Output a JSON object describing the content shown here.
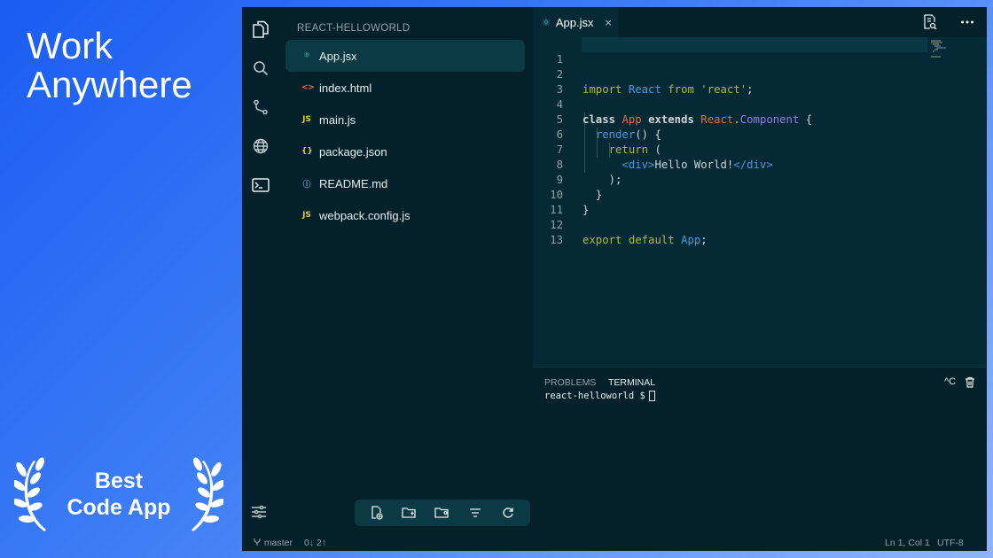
{
  "promo": {
    "headline_line1": "Work",
    "headline_line2": "Anywhere",
    "award_line1": "Best",
    "award_line2": "Code App"
  },
  "activity_bar": {
    "items": [
      "files-icon",
      "search-icon",
      "source-control-icon",
      "globe-icon",
      "terminal-icon"
    ],
    "bottom": "settings-sliders-icon"
  },
  "sidebar": {
    "title": "REACT-HELLOWORLD",
    "files": [
      {
        "name": "App.jsx",
        "icon": "⚛",
        "icon_color": "#6bb8ce",
        "active": true
      },
      {
        "name": "index.html",
        "icon": "<>",
        "icon_color": "#ea6b3c",
        "active": false
      },
      {
        "name": "main.js",
        "icon": "JS",
        "icon_color": "#e4c84c",
        "active": false
      },
      {
        "name": "package.json",
        "icon": "{}",
        "icon_color": "#e4c84c",
        "active": false
      },
      {
        "name": "README.md",
        "icon": "ⓘ",
        "icon_color": "#6bb8ce",
        "active": false
      },
      {
        "name": "webpack.config.js",
        "icon": "JS",
        "icon_color": "#e4c84c",
        "active": false
      }
    ],
    "toolbar": [
      "new-file-icon",
      "new-folder-icon",
      "open-folder-icon",
      "filter-icon",
      "refresh-icon"
    ]
  },
  "editor": {
    "tab": {
      "label": "App.jsx",
      "icon": "⚛",
      "close": "×"
    },
    "lines": [
      "1",
      "2",
      "3",
      "4",
      "5",
      "6",
      "7",
      "8",
      "9",
      "10",
      "11",
      "12",
      "13"
    ],
    "code": {
      "import_kw": "import",
      "import_name": "React",
      "from_kw": "from",
      "import_src": "'react'",
      "semi": ";",
      "class_kw": "class",
      "class_name": "App",
      "extends_kw": "extends",
      "base_obj": "React",
      "dot": ".",
      "base_cls": "Component",
      "open_brace": "{",
      "render_fn": "render",
      "render_parens": "() {",
      "return_kw": "return",
      "return_paren": "(",
      "tag_open": "<div>",
      "jsx_text": "Hello World!",
      "tag_close": "</div>",
      "close_paren": ");",
      "close_brace": "}",
      "export_kw": "export",
      "default_kw": "default",
      "export_name": "App"
    }
  },
  "panel": {
    "tabs": [
      "PROBLEMS",
      "TERMINAL"
    ],
    "active_tab": "TERMINAL",
    "ctrl_c": "^C",
    "prompt": "react-helloworld $"
  },
  "statusbar": {
    "branch": "master",
    "sync": "0↓ 2↑",
    "position": "Ln 1, Col 1",
    "encoding": "UTF-8"
  },
  "colors": {
    "window_bg": "#04202a",
    "editor_bg": "#052a35",
    "accent_active": "#0b3a44"
  }
}
